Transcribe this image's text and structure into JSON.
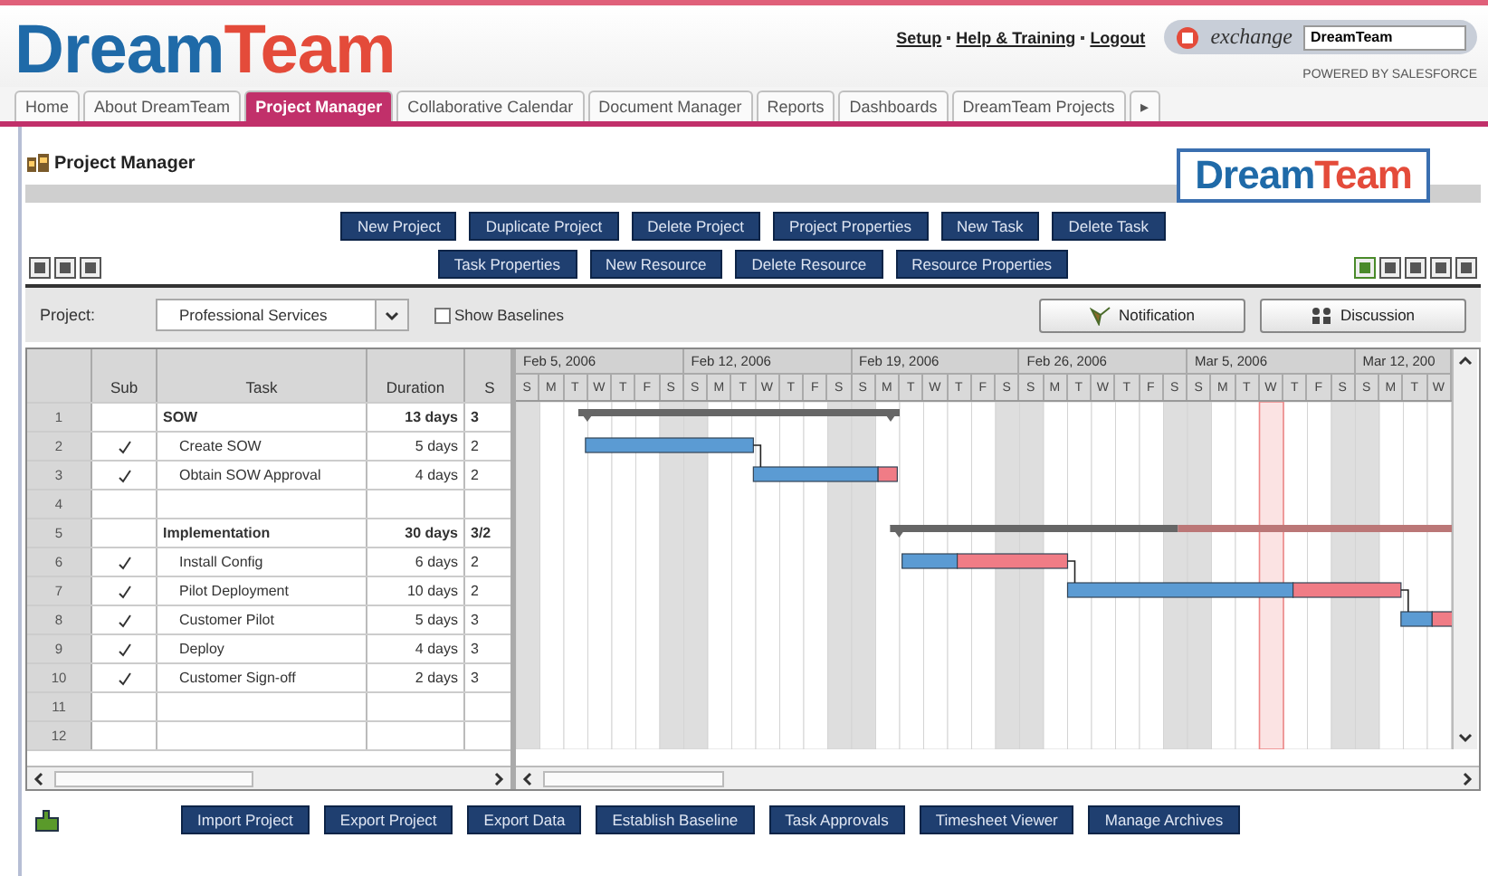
{
  "header": {
    "logo": {
      "part_1": "Dream",
      "part_2": "Team"
    },
    "links": [
      "Setup",
      "Help & Training",
      "Logout"
    ],
    "exchange": {
      "label": "exchange",
      "value": "DreamTeam"
    },
    "powered_by": "POWERED BY SALESFORCE"
  },
  "tabs": [
    {
      "label": "Home",
      "selected": false
    },
    {
      "label": "About DreamTeam",
      "selected": false
    },
    {
      "label": "Project Manager",
      "selected": true
    },
    {
      "label": "Collaborative Calendar",
      "selected": false
    },
    {
      "label": "Document Manager",
      "selected": false
    },
    {
      "label": "Reports",
      "selected": false
    },
    {
      "label": "Dashboards",
      "selected": false
    },
    {
      "label": "DreamTeam Projects",
      "selected": false
    },
    {
      "label": "▸",
      "selected": false
    }
  ],
  "page": {
    "title": "Project Manager",
    "logo": {
      "part_1": "Dream",
      "part_2": "Team"
    }
  },
  "action_buttons": [
    [
      "New Project",
      "Duplicate Project",
      "Delete Project",
      "Project Properties",
      "New Task",
      "Delete Task"
    ],
    [
      "Task Properties",
      "New Resource",
      "Delete Resource",
      "Resource Properties"
    ]
  ],
  "toolbar": {
    "project_label": "Project:",
    "project_value": "Professional Services",
    "show_baselines": {
      "label": "Show Baselines",
      "checked": false
    },
    "buttons": [
      "Notification",
      "Discussion"
    ]
  },
  "table": {
    "columns": [
      "",
      "Sub",
      "Task",
      "Duration",
      "S"
    ],
    "rows": [
      {
        "number": "1",
        "sub": false,
        "summary": true,
        "task": "SOW",
        "duration": "13 days",
        "column_5": "3"
      },
      {
        "number": "2",
        "sub": true,
        "summary": false,
        "task": "Create SOW",
        "duration": "5 days",
        "column_5": "2"
      },
      {
        "number": "3",
        "sub": true,
        "summary": false,
        "task": "Obtain SOW Approval",
        "duration": "4 days",
        "column_5": "2"
      },
      {
        "number": "4",
        "sub": false
      },
      {
        "number": "5",
        "sub": false,
        "summary": true,
        "task": "Implementation",
        "duration": "30 days",
        "column_5": "3/2"
      },
      {
        "number": "6",
        "sub": true,
        "summary": false,
        "task": "Install Config",
        "duration": "6 days",
        "column_5": "2"
      },
      {
        "number": "7",
        "sub": true,
        "summary": false,
        "task": "Pilot Deployment",
        "duration": "10 days",
        "column_5": "2"
      },
      {
        "number": "8",
        "sub": true,
        "summary": false,
        "task": "Customer Pilot",
        "duration": "5 days",
        "column_5": "3"
      },
      {
        "number": "9",
        "sub": true,
        "summary": false,
        "task": "Deploy",
        "duration": "4 days",
        "column_5": "3"
      },
      {
        "number": "10",
        "sub": true,
        "summary": false,
        "task": "Customer Sign-off",
        "duration": "2 days",
        "column_5": "3"
      },
      {
        "number": "11",
        "sub": false
      },
      {
        "number": "12",
        "sub": false
      }
    ]
  },
  "gantt": {
    "weeks": [
      "Feb 5, 2006",
      "Feb 12, 2006",
      "Feb 19, 2006",
      "Feb 26, 2006",
      "Mar 5, 2006",
      "Mar 12, 200"
    ],
    "days": [
      "S",
      "M",
      "T",
      "W",
      "T",
      "F",
      "S",
      "S",
      "M",
      "T",
      "W",
      "T",
      "F",
      "S",
      "S",
      "M",
      "T",
      "W",
      "T",
      "F",
      "S",
      "S",
      "M",
      "T",
      "W",
      "T",
      "F",
      "S",
      "S",
      "M",
      "T",
      "W",
      "T",
      "F",
      "S",
      "S",
      "M",
      "T",
      "W"
    ]
  },
  "bottom_buttons": [
    "Import Project",
    "Export Project",
    "Export Data",
    "Establish Baseline",
    "Task Approvals",
    "Timesheet Viewer",
    "Manage Archives"
  ]
}
